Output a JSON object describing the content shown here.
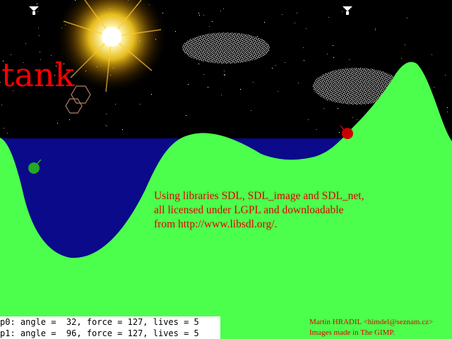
{
  "game": {
    "title": "tank"
  },
  "credits": {
    "lines": [
      "Using libraries SDL, SDL_image and SDL_net,",
      "all licensed under LGPL and downloadable",
      "from http://www.libsdl.org/."
    ]
  },
  "status": {
    "players": [
      "p0: angle =  32, force = 127, lives = 5",
      "p1: angle =  96, force = 127, lives = 5"
    ]
  },
  "author": {
    "name_line": "Martin HRADIL <himdel@seznam.cz>",
    "gimp_line": "Images made in The GIMP."
  },
  "colors": {
    "sky": "#000000",
    "water": "#0a0a8a",
    "ground": "#4cff4c",
    "text_red": "#ff0000",
    "tank_p0": "#22aa22",
    "tank_p1": "#cc0000"
  },
  "players": [
    {
      "name": "p0",
      "angle": 32,
      "force": 127,
      "lives": 5
    },
    {
      "name": "p1",
      "angle": 96,
      "force": 127,
      "lives": 5
    }
  ]
}
